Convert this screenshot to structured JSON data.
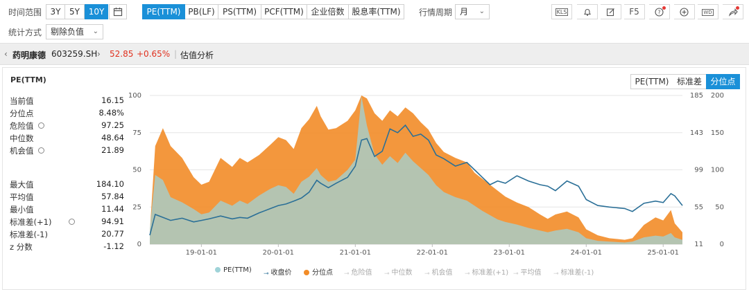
{
  "toolbar": {
    "time_range_label": "时间范围",
    "ranges": [
      "3Y",
      "5Y",
      "10Y"
    ],
    "active_range": "10Y",
    "metric_tabs": [
      "PE(TTM)",
      "PB(LF)",
      "PS(TTM)",
      "PCF(TTM)",
      "企业倍数",
      "股息率(TTM)"
    ],
    "active_metric": "PE(TTM)",
    "period_label": "行情周期",
    "period_value": "月",
    "icons": [
      "kls-icon",
      "bell-icon",
      "edit-icon",
      "f5-refresh",
      "help-icon",
      "add-icon",
      "export-word-icon",
      "share-icon"
    ],
    "f5_label": "F5",
    "kls_label": "KLS",
    "word_label": "WD",
    "stat_method_label": "统计方式",
    "stat_method_value": "剔除负值"
  },
  "stock": {
    "name": "药明康德",
    "code": "603259.SH",
    "price": "52.85",
    "change": "+0.65%",
    "section": "估值分析",
    "up_color": "#e0301e"
  },
  "panel": {
    "title": "PE(TTM)",
    "modes": [
      "PE(TTM)",
      "标准差",
      "分位点"
    ],
    "active_mode": "分位点"
  },
  "stats_top": [
    {
      "label": "当前值",
      "value": "16.15",
      "gear": false
    },
    {
      "label": "分位点",
      "value": "8.48%",
      "gear": false
    },
    {
      "label": "危险值",
      "value": "97.25",
      "gear": true
    },
    {
      "label": "中位数",
      "value": "48.64",
      "gear": false
    },
    {
      "label": "机会值",
      "value": "21.89",
      "gear": true
    }
  ],
  "stats_bottom": [
    {
      "label": "最大值",
      "value": "184.10",
      "gear": false
    },
    {
      "label": "平均值",
      "value": "57.84",
      "gear": false
    },
    {
      "label": "最小值",
      "value": "11.44",
      "gear": false
    },
    {
      "label": "标准差(+1)",
      "value": "94.91",
      "gear": true
    },
    {
      "label": "标准差(-1)",
      "value": "20.77",
      "gear": false
    },
    {
      "label": "z 分数",
      "value": "-1.12",
      "gear": false
    }
  ],
  "legend": [
    {
      "label": "PE(TTM)",
      "color": "#9fd3d8",
      "active": true,
      "marker": "dot"
    },
    {
      "label": "收盘价",
      "color": "#2a6f97",
      "active": true,
      "marker": "line"
    },
    {
      "label": "分位点",
      "color": "#f28c28",
      "active": true,
      "marker": "dot"
    },
    {
      "label": "危险值",
      "color": "#c8c8c8",
      "active": false,
      "marker": "line"
    },
    {
      "label": "中位数",
      "color": "#c8c8c8",
      "active": false,
      "marker": "line"
    },
    {
      "label": "机会值",
      "color": "#c8c8c8",
      "active": false,
      "marker": "line"
    },
    {
      "label": "标准差(+1)",
      "color": "#c8c8c8",
      "active": false,
      "marker": "line"
    },
    {
      "label": "平均值",
      "color": "#c8c8c8",
      "active": false,
      "marker": "line"
    },
    {
      "label": "标准差(-1)",
      "color": "#c8c8c8",
      "active": false,
      "marker": "line"
    }
  ],
  "chart_data": {
    "type": "area",
    "x_ticks": [
      "19-01-01",
      "20-01-01",
      "21-01-01",
      "22-01-01",
      "23-01-01",
      "24-01-01",
      "25-01-01"
    ],
    "y_left_ticks": [
      "0",
      "25",
      "50",
      "75",
      "100"
    ],
    "y_left_range": [
      0,
      100
    ],
    "y_right1_ticks": [
      "11",
      "55",
      "99",
      "143",
      "185"
    ],
    "y_right1_range": [
      11,
      185
    ],
    "y_right2_ticks": [
      "0",
      "50",
      "100",
      "150",
      "200"
    ],
    "y_right2_range": [
      0,
      200
    ],
    "t_start": 2018.33,
    "t_end": 2025.25,
    "grid": true,
    "series": [
      {
        "name": "分位点",
        "axis": "left",
        "color": "#f28c28",
        "points": [
          [
            2018.33,
            8
          ],
          [
            2018.4,
            66
          ],
          [
            2018.5,
            78
          ],
          [
            2018.6,
            66
          ],
          [
            2018.75,
            58
          ],
          [
            2018.9,
            45
          ],
          [
            2019.0,
            40
          ],
          [
            2019.1,
            42
          ],
          [
            2019.25,
            58
          ],
          [
            2019.4,
            52
          ],
          [
            2019.5,
            58
          ],
          [
            2019.6,
            55
          ],
          [
            2019.75,
            60
          ],
          [
            2019.9,
            67
          ],
          [
            2020.0,
            72
          ],
          [
            2020.1,
            70
          ],
          [
            2020.2,
            64
          ],
          [
            2020.3,
            78
          ],
          [
            2020.4,
            84
          ],
          [
            2020.5,
            93
          ],
          [
            2020.55,
            86
          ],
          [
            2020.65,
            77
          ],
          [
            2020.75,
            78
          ],
          [
            2020.9,
            83
          ],
          [
            2021.0,
            90
          ],
          [
            2021.08,
            100
          ],
          [
            2021.15,
            98
          ],
          [
            2021.25,
            88
          ],
          [
            2021.35,
            83
          ],
          [
            2021.45,
            90
          ],
          [
            2021.55,
            86
          ],
          [
            2021.65,
            92
          ],
          [
            2021.75,
            88
          ],
          [
            2021.85,
            82
          ],
          [
            2021.95,
            77
          ],
          [
            2022.05,
            68
          ],
          [
            2022.15,
            62
          ],
          [
            2022.3,
            58
          ],
          [
            2022.45,
            55
          ],
          [
            2022.55,
            48
          ],
          [
            2022.65,
            44
          ],
          [
            2022.75,
            40
          ],
          [
            2022.85,
            36
          ],
          [
            2022.95,
            32
          ],
          [
            2023.1,
            28
          ],
          [
            2023.25,
            25
          ],
          [
            2023.4,
            20
          ],
          [
            2023.5,
            17
          ],
          [
            2023.6,
            20
          ],
          [
            2023.75,
            22
          ],
          [
            2023.9,
            18
          ],
          [
            2024.0,
            10
          ],
          [
            2024.15,
            6
          ],
          [
            2024.3,
            4
          ],
          [
            2024.5,
            3
          ],
          [
            2024.6,
            4
          ],
          [
            2024.75,
            13
          ],
          [
            2024.9,
            18
          ],
          [
            2025.0,
            16
          ],
          [
            2025.1,
            23
          ],
          [
            2025.15,
            14
          ],
          [
            2025.25,
            8
          ]
        ]
      },
      {
        "name": "PE(TTM)",
        "axis": "right1",
        "color": "#9fd3d8",
        "points": [
          [
            2018.33,
            28
          ],
          [
            2018.4,
            92
          ],
          [
            2018.5,
            86
          ],
          [
            2018.6,
            66
          ],
          [
            2018.75,
            60
          ],
          [
            2018.9,
            52
          ],
          [
            2019.0,
            46
          ],
          [
            2019.1,
            48
          ],
          [
            2019.25,
            62
          ],
          [
            2019.4,
            56
          ],
          [
            2019.5,
            62
          ],
          [
            2019.6,
            58
          ],
          [
            2019.75,
            68
          ],
          [
            2019.9,
            76
          ],
          [
            2020.0,
            80
          ],
          [
            2020.1,
            78
          ],
          [
            2020.2,
            70
          ],
          [
            2020.3,
            84
          ],
          [
            2020.4,
            90
          ],
          [
            2020.5,
            100
          ],
          [
            2020.55,
            92
          ],
          [
            2020.65,
            84
          ],
          [
            2020.75,
            86
          ],
          [
            2020.9,
            98
          ],
          [
            2021.0,
            110
          ],
          [
            2021.08,
            184
          ],
          [
            2021.15,
            150
          ],
          [
            2021.25,
            116
          ],
          [
            2021.35,
            104
          ],
          [
            2021.45,
            114
          ],
          [
            2021.55,
            106
          ],
          [
            2021.65,
            118
          ],
          [
            2021.75,
            108
          ],
          [
            2021.85,
            100
          ],
          [
            2021.95,
            92
          ],
          [
            2022.05,
            80
          ],
          [
            2022.15,
            72
          ],
          [
            2022.3,
            66
          ],
          [
            2022.45,
            62
          ],
          [
            2022.55,
            56
          ],
          [
            2022.65,
            50
          ],
          [
            2022.75,
            45
          ],
          [
            2022.85,
            40
          ],
          [
            2022.95,
            37
          ],
          [
            2023.1,
            34
          ],
          [
            2023.25,
            30
          ],
          [
            2023.4,
            27
          ],
          [
            2023.5,
            25
          ],
          [
            2023.6,
            27
          ],
          [
            2023.75,
            29
          ],
          [
            2023.9,
            25
          ],
          [
            2024.0,
            18
          ],
          [
            2024.15,
            15
          ],
          [
            2024.3,
            14
          ],
          [
            2024.5,
            13
          ],
          [
            2024.6,
            14
          ],
          [
            2024.75,
            19
          ],
          [
            2024.9,
            21
          ],
          [
            2025.0,
            20
          ],
          [
            2025.1,
            24
          ],
          [
            2025.15,
            19
          ],
          [
            2025.25,
            16
          ]
        ]
      },
      {
        "name": "收盘价",
        "axis": "right2",
        "color": "#2a6f97",
        "points": [
          [
            2018.33,
            12
          ],
          [
            2018.4,
            40
          ],
          [
            2018.5,
            36
          ],
          [
            2018.6,
            32
          ],
          [
            2018.75,
            35
          ],
          [
            2018.9,
            30
          ],
          [
            2019.0,
            32
          ],
          [
            2019.1,
            34
          ],
          [
            2019.25,
            38
          ],
          [
            2019.4,
            34
          ],
          [
            2019.5,
            36
          ],
          [
            2019.6,
            35
          ],
          [
            2019.75,
            42
          ],
          [
            2019.9,
            48
          ],
          [
            2020.0,
            52
          ],
          [
            2020.1,
            54
          ],
          [
            2020.2,
            58
          ],
          [
            2020.3,
            62
          ],
          [
            2020.4,
            70
          ],
          [
            2020.5,
            86
          ],
          [
            2020.55,
            82
          ],
          [
            2020.65,
            76
          ],
          [
            2020.75,
            82
          ],
          [
            2020.9,
            90
          ],
          [
            2021.0,
            105
          ],
          [
            2021.08,
            140
          ],
          [
            2021.15,
            142
          ],
          [
            2021.25,
            118
          ],
          [
            2021.35,
            125
          ],
          [
            2021.45,
            155
          ],
          [
            2021.55,
            150
          ],
          [
            2021.65,
            160
          ],
          [
            2021.75,
            145
          ],
          [
            2021.85,
            148
          ],
          [
            2021.95,
            140
          ],
          [
            2022.05,
            120
          ],
          [
            2022.15,
            115
          ],
          [
            2022.3,
            105
          ],
          [
            2022.45,
            110
          ],
          [
            2022.55,
            100
          ],
          [
            2022.65,
            90
          ],
          [
            2022.75,
            80
          ],
          [
            2022.85,
            85
          ],
          [
            2022.95,
            82
          ],
          [
            2023.1,
            92
          ],
          [
            2023.25,
            85
          ],
          [
            2023.4,
            80
          ],
          [
            2023.5,
            78
          ],
          [
            2023.6,
            72
          ],
          [
            2023.75,
            85
          ],
          [
            2023.9,
            78
          ],
          [
            2024.0,
            60
          ],
          [
            2024.15,
            52
          ],
          [
            2024.3,
            50
          ],
          [
            2024.5,
            48
          ],
          [
            2024.6,
            44
          ],
          [
            2024.75,
            55
          ],
          [
            2024.9,
            58
          ],
          [
            2025.0,
            56
          ],
          [
            2025.1,
            68
          ],
          [
            2025.15,
            65
          ],
          [
            2025.25,
            52
          ]
        ]
      }
    ]
  }
}
